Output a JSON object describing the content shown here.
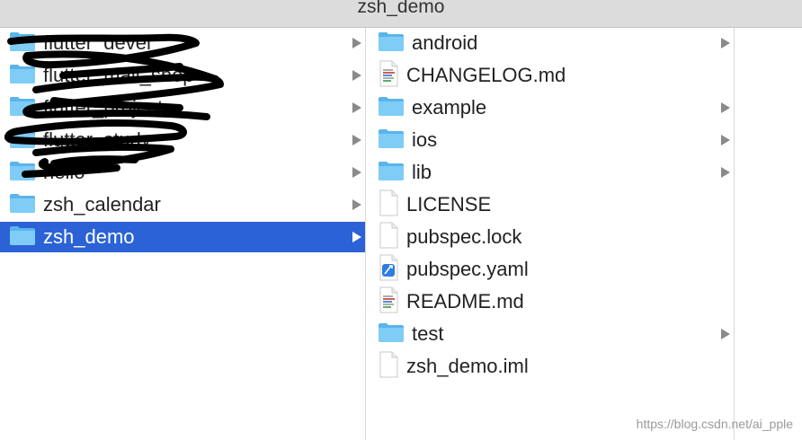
{
  "window": {
    "title": "zsh_demo"
  },
  "column1": {
    "items": [
      {
        "label": "flutter_devel",
        "icon": "folder-icon",
        "has_children": true,
        "redacted": true
      },
      {
        "label": "flutter_mall_shop",
        "icon": "folder-icon",
        "has_children": true,
        "redacted": true
      },
      {
        "label": "flutter_project",
        "icon": "folder-icon",
        "has_children": true,
        "redacted": true
      },
      {
        "label": "flutter_study",
        "icon": "folder-icon",
        "has_children": true,
        "redacted": true
      },
      {
        "label": "hello",
        "icon": "folder-icon",
        "has_children": true,
        "redacted": true
      },
      {
        "label": "zsh_calendar",
        "icon": "folder-icon",
        "has_children": true,
        "redacted": false
      },
      {
        "label": "zsh_demo",
        "icon": "folder-icon",
        "has_children": true,
        "redacted": false,
        "selected": true
      }
    ]
  },
  "column2": {
    "items": [
      {
        "label": "android",
        "icon": "folder-icon",
        "has_children": true
      },
      {
        "label": "CHANGELOG.md",
        "icon": "text-document-icon",
        "has_children": false
      },
      {
        "label": "example",
        "icon": "folder-icon",
        "has_children": true
      },
      {
        "label": "ios",
        "icon": "folder-icon",
        "has_children": true
      },
      {
        "label": "lib",
        "icon": "folder-icon",
        "has_children": true
      },
      {
        "label": "LICENSE",
        "icon": "blank-document-icon",
        "has_children": false
      },
      {
        "label": "pubspec.lock",
        "icon": "blank-document-icon",
        "has_children": false
      },
      {
        "label": "pubspec.yaml",
        "icon": "xcode-document-icon",
        "has_children": false
      },
      {
        "label": "README.md",
        "icon": "text-document-icon",
        "has_children": false
      },
      {
        "label": "test",
        "icon": "folder-icon",
        "has_children": true
      },
      {
        "label": "zsh_demo.iml",
        "icon": "blank-document-icon",
        "has_children": false
      }
    ]
  },
  "watermark": "https://blog.csdn.net/ai_pple",
  "colors": {
    "selection": "#2b63d6",
    "folder": "#6ec3f4",
    "chevron": "#8a8a8a",
    "titlebar": "#dcdcdc"
  }
}
